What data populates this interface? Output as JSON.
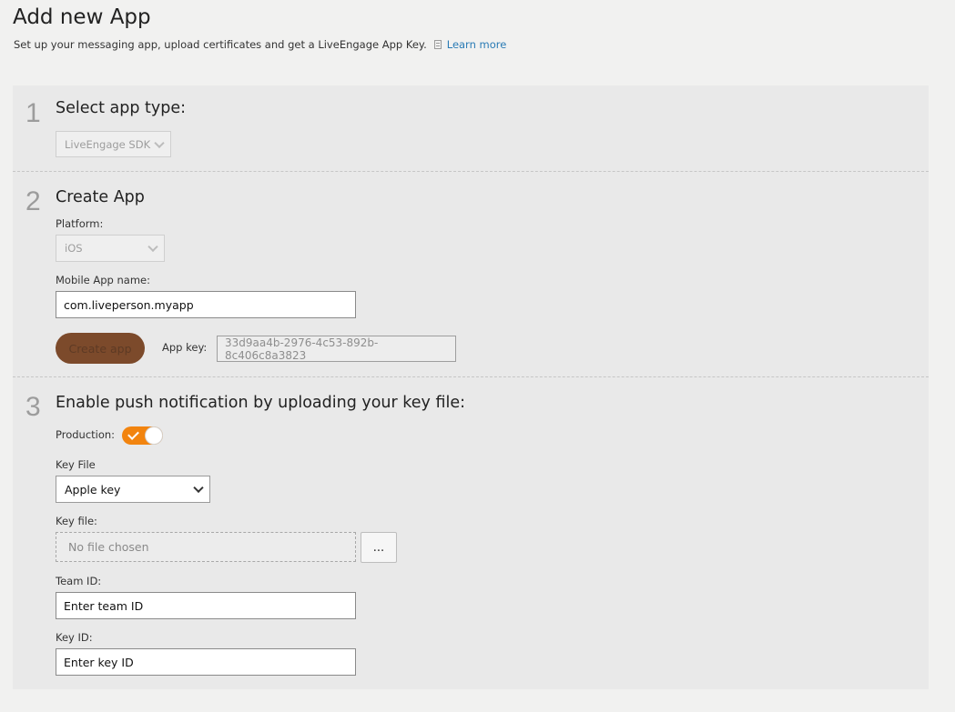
{
  "header": {
    "title": "Add new App",
    "subtitle": "Set up your messaging app, upload certificates and get a LiveEngage App Key.",
    "learn_more": "Learn more"
  },
  "step1": {
    "number": "1",
    "title": "Select app type:",
    "app_type": "LiveEngage SDK"
  },
  "step2": {
    "number": "2",
    "title": "Create App",
    "platform_label": "Platform:",
    "platform_value": "iOS",
    "app_name_label": "Mobile App name:",
    "app_name_value": "com.liveperson.myapp",
    "create_button": "Create app",
    "app_key_label": "App key:",
    "app_key_value": "33d9aa4b-2976-4c53-892b-8c406c8a3823"
  },
  "step3": {
    "number": "3",
    "title": "Enable push notification by uploading your key file:",
    "production_label": "Production:",
    "production_on": true,
    "key_file_type_label": "Key File",
    "key_file_type_value": "Apple key",
    "key_file_label": "Key file:",
    "key_file_placeholder": "No file chosen",
    "browse_label": "...",
    "team_id_label": "Team ID:",
    "team_id_value": "Enter team ID",
    "key_id_label": "Key ID:",
    "key_id_value": "Enter key ID"
  },
  "colors": {
    "accent_orange": "#f2840f",
    "create_button_brown": "#7c4a2b",
    "link_blue": "#2a7bb5"
  },
  "icons": {
    "doc": "document-icon",
    "chevron": "chevron-down-icon",
    "check": "check-icon"
  }
}
